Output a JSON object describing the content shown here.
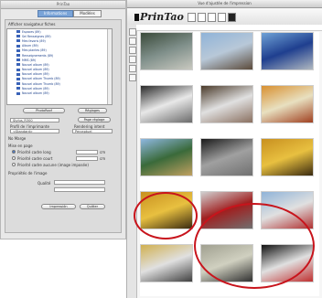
{
  "settings_window": {
    "title": "PrinTao",
    "tabs": [
      "Informations",
      "Modèles"
    ],
    "tree_label": "Afficher navigateur fiches",
    "tree_items": [
      "Espaces (89)",
      "Sel Renseignes (89)",
      "Mes favoris (89)",
      "Album (89)",
      "Mes plantes (89)",
      "Renseignements (89)",
      "MMS (89)",
      "Nouvel album (89)",
      "Nouvel album (89)",
      "Nouvel album (89)",
      "Nouvel album Thumb (89)",
      "Nouvel album Thumb (89)",
      "Nouvel album (89)",
      "Nouvel album (89)"
    ],
    "photo_button": "PhotoRoof",
    "reglages_button": "Réglages",
    "printer_label": "Stylus_R300",
    "page_setup_button": "Page réglage",
    "profile_label": "Profil de l'imprimante",
    "profile_value": "<Standard>",
    "rendering_label": "Rendering intent",
    "rendering_value": "Perceptuel",
    "no_margin_label": "No Marge",
    "options_label": "Mise en page",
    "option1": "Priorité cadre long",
    "option2": "Priorité cadre court",
    "option3": "Priorité cadre aucune (image imposée)",
    "group_label": "Propriétés de l'image",
    "qualite_label": "Qualité",
    "unit1": "cm",
    "unit2": "cm",
    "cancel_button": "Impressión",
    "quit_button": "Quitter"
  },
  "preview_window": {
    "title": "Vue d'ajustée de l'impression",
    "logo": "PrinTao"
  },
  "thumbnails": [
    {
      "name": "thumb-leaves",
      "colors": [
        "#3a4a3a",
        "#7f8f8a",
        "#c9c9c0"
      ]
    },
    {
      "name": "thumb-plane-mountain",
      "colors": [
        "#8fb3d8",
        "#b8c8d8",
        "#5b4a3a"
      ]
    },
    {
      "name": "thumb-blue-car",
      "colors": [
        "#6fa2d6",
        "#1f3f8f",
        "#b0b8c0"
      ]
    },
    {
      "name": "thumb-jet",
      "colors": [
        "#2a2a2a",
        "#e8e8e8",
        "#6a6a6a"
      ]
    },
    {
      "name": "thumb-car-white",
      "colors": [
        "#4a3a2a",
        "#e0e0e0",
        "#8a7060"
      ]
    },
    {
      "name": "thumb-food",
      "colors": [
        "#d89030",
        "#e8e0c0",
        "#a04020"
      ]
    },
    {
      "name": "thumb-cactus",
      "colors": [
        "#8fb8e0",
        "#3a6a3a",
        "#c0a060"
      ]
    },
    {
      "name": "thumb-doorway",
      "colors": [
        "#1a1a1a",
        "#a0a0a0",
        "#707070"
      ]
    },
    {
      "name": "thumb-yellow-arch",
      "colors": [
        "#c89020",
        "#e8c040",
        "#3a2a10"
      ]
    },
    {
      "name": "thumb-yellow-arch-2",
      "colors": [
        "#c89020",
        "#e8c040",
        "#3a2a10"
      ]
    },
    {
      "name": "thumb-red-sign",
      "colors": [
        "#d0d0d0",
        "#a02020",
        "#707070"
      ]
    },
    {
      "name": "thumb-bus-side",
      "colors": [
        "#8fb3d8",
        "#e0e0e0",
        "#b03030"
      ]
    },
    {
      "name": "thumb-bus-yellow",
      "colors": [
        "#d0b050",
        "#e0e0e0",
        "#404040"
      ]
    },
    {
      "name": "thumb-stone-sign",
      "colors": [
        "#a0a090",
        "#d0d0c0",
        "#303030"
      ]
    },
    {
      "name": "thumb-plane-night",
      "colors": [
        "#101010",
        "#e0e0e0",
        "#c03030"
      ]
    }
  ],
  "annotation_color": "#c8141c"
}
